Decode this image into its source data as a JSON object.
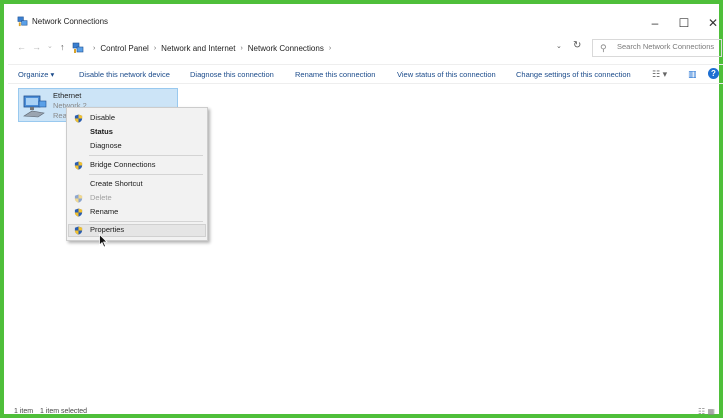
{
  "window": {
    "title": "Network Connections",
    "minimize_glyph": "–",
    "maximize_glyph": "☐",
    "close_glyph": "✕"
  },
  "nav": {
    "back_glyph": "←",
    "forward_glyph": "→",
    "recent_glyph": "⌄",
    "up_glyph": "↑"
  },
  "breadcrumb": {
    "items": [
      "Control Panel",
      "Network and Internet",
      "Network Connections"
    ],
    "separator": "›"
  },
  "address": {
    "dropdown_glyph": "⌄",
    "refresh_glyph": "↻"
  },
  "search": {
    "placeholder": "Search Network Connections"
  },
  "toolbar": {
    "organize": "Organize ▾",
    "disable": "Disable this network device",
    "diagnose": "Diagnose this connection",
    "rename": "Rename this connection",
    "view_status": "View status of this connection",
    "change_settings": "Change settings of this connection",
    "view_glyph": "☷ ▾",
    "pane_glyph": "▥",
    "help_glyph": "?"
  },
  "connection": {
    "name": "Ethernet",
    "network": "Network 2",
    "status": "Rea"
  },
  "context_menu": {
    "disable": "Disable",
    "status": "Status",
    "diagnose": "Diagnose",
    "bridge": "Bridge Connections",
    "shortcut": "Create Shortcut",
    "delete": "Delete",
    "rename": "Rename",
    "properties": "Properties"
  },
  "statusbar": {
    "count": "1 item",
    "selected": "1 item selected",
    "view_glyph": "☷ ▦"
  },
  "colors": {
    "frame_border": "#4fbf3a",
    "selection_bg": "#cce4f7",
    "link_blue": "#1a4a8a",
    "help_blue": "#1e6fd1",
    "shield_blue": "#2a5db0",
    "shield_yellow": "#f2c12e"
  },
  "icons": {
    "app": "network-connections-icon",
    "shield": "uac-shield-icon",
    "ethernet": "ethernet-adapter-icon",
    "cursor": "mouse-pointer-icon"
  }
}
